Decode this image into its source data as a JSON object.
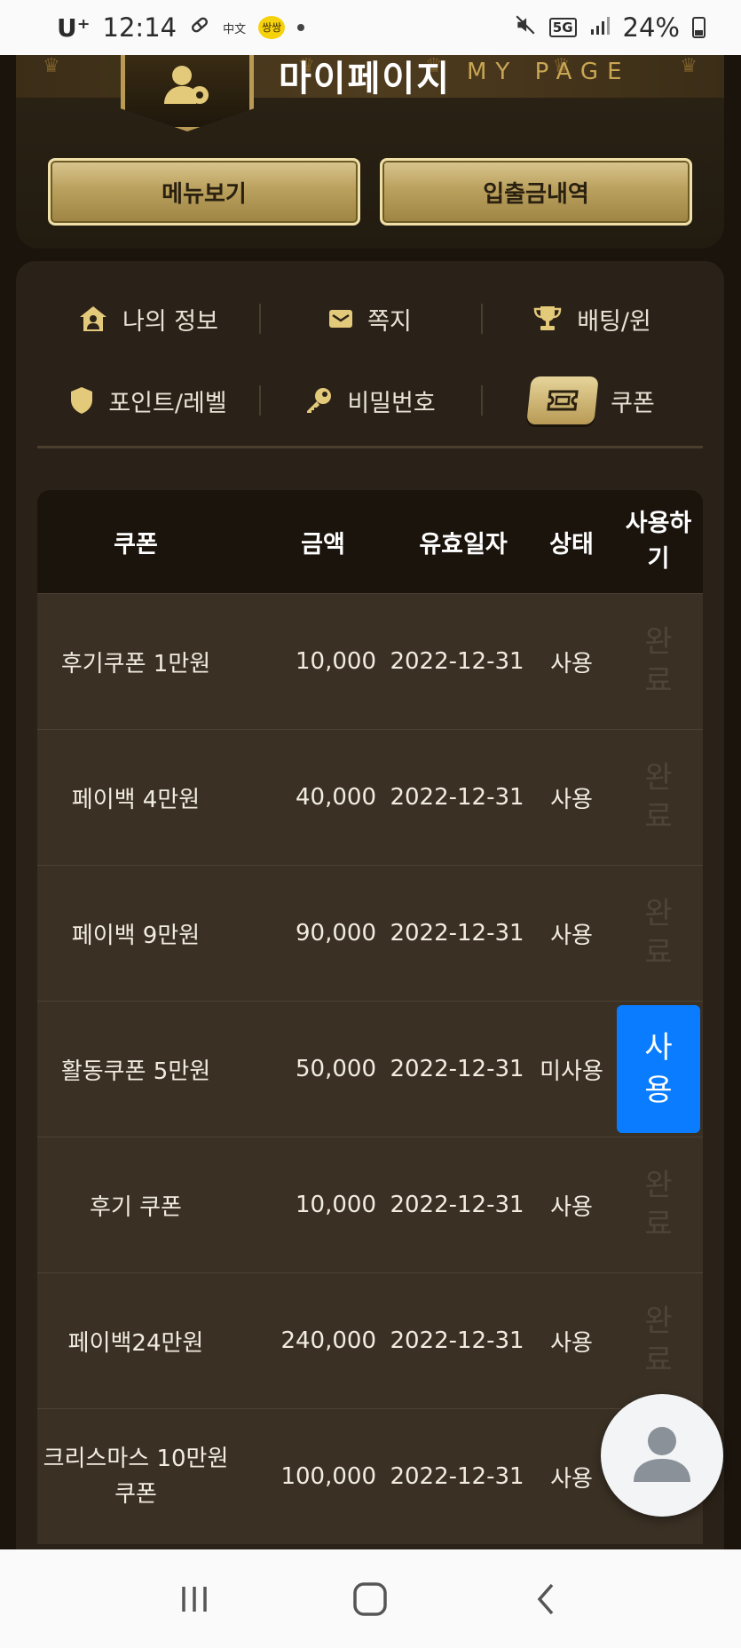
{
  "status_bar": {
    "carrier": "U⁺",
    "time": "12:14",
    "ime_label": "中文",
    "kakao_label": "쌍쌍",
    "network": "5G",
    "battery": "24%"
  },
  "header": {
    "title": "마이페이지",
    "subtitle": "MY PAGE",
    "menu_button": "메뉴보기",
    "deposit_button": "입출금내역"
  },
  "tabs": [
    {
      "label": "나의 정보",
      "icon": "home-user-icon"
    },
    {
      "label": "쪽지",
      "icon": "envelope-icon"
    },
    {
      "label": "배팅/윈",
      "icon": "trophy-icon"
    },
    {
      "label": "포인트/레벨",
      "icon": "shield-icon"
    },
    {
      "label": "비밀번호",
      "icon": "key-icon"
    },
    {
      "label": "쿠폰",
      "icon": "ticket-icon",
      "active": true
    }
  ],
  "table": {
    "headers": {
      "name": "쿠폰",
      "amount": "금액",
      "expiry": "유효일자",
      "status": "상태",
      "use_line1": "사용하",
      "use_line2": "기"
    },
    "done_line1": "완",
    "done_line2": "료",
    "use_line1": "사",
    "use_line2": "용",
    "rows": [
      {
        "name": "후기쿠폰 1만원",
        "amount": "10,000",
        "expiry": "2022-12-31",
        "status": "사용"
      },
      {
        "name": "페이백 4만원",
        "amount": "40,000",
        "expiry": "2022-12-31",
        "status": "사용"
      },
      {
        "name": "페이백 9만원",
        "amount": "90,000",
        "expiry": "2022-12-31",
        "status": "사용"
      },
      {
        "name": "활동쿠폰 5만원",
        "amount": "50,000",
        "expiry": "2022-12-31",
        "status": "미사용"
      },
      {
        "name": "후기 쿠폰",
        "amount": "10,000",
        "expiry": "2022-12-31",
        "status": "사용"
      },
      {
        "name": "페이백24만원",
        "amount": "240,000",
        "expiry": "2022-12-31",
        "status": "사용"
      },
      {
        "name_line1": "크리스마스 10만원",
        "name_line2": "쿠폰",
        "amount": "100,000",
        "expiry": "2022-12-31",
        "status": "사용"
      }
    ]
  },
  "colors": {
    "gold": "#b89a55",
    "use_button": "#0a7cff",
    "panel": "#2a2218",
    "row": "#3a3024"
  }
}
